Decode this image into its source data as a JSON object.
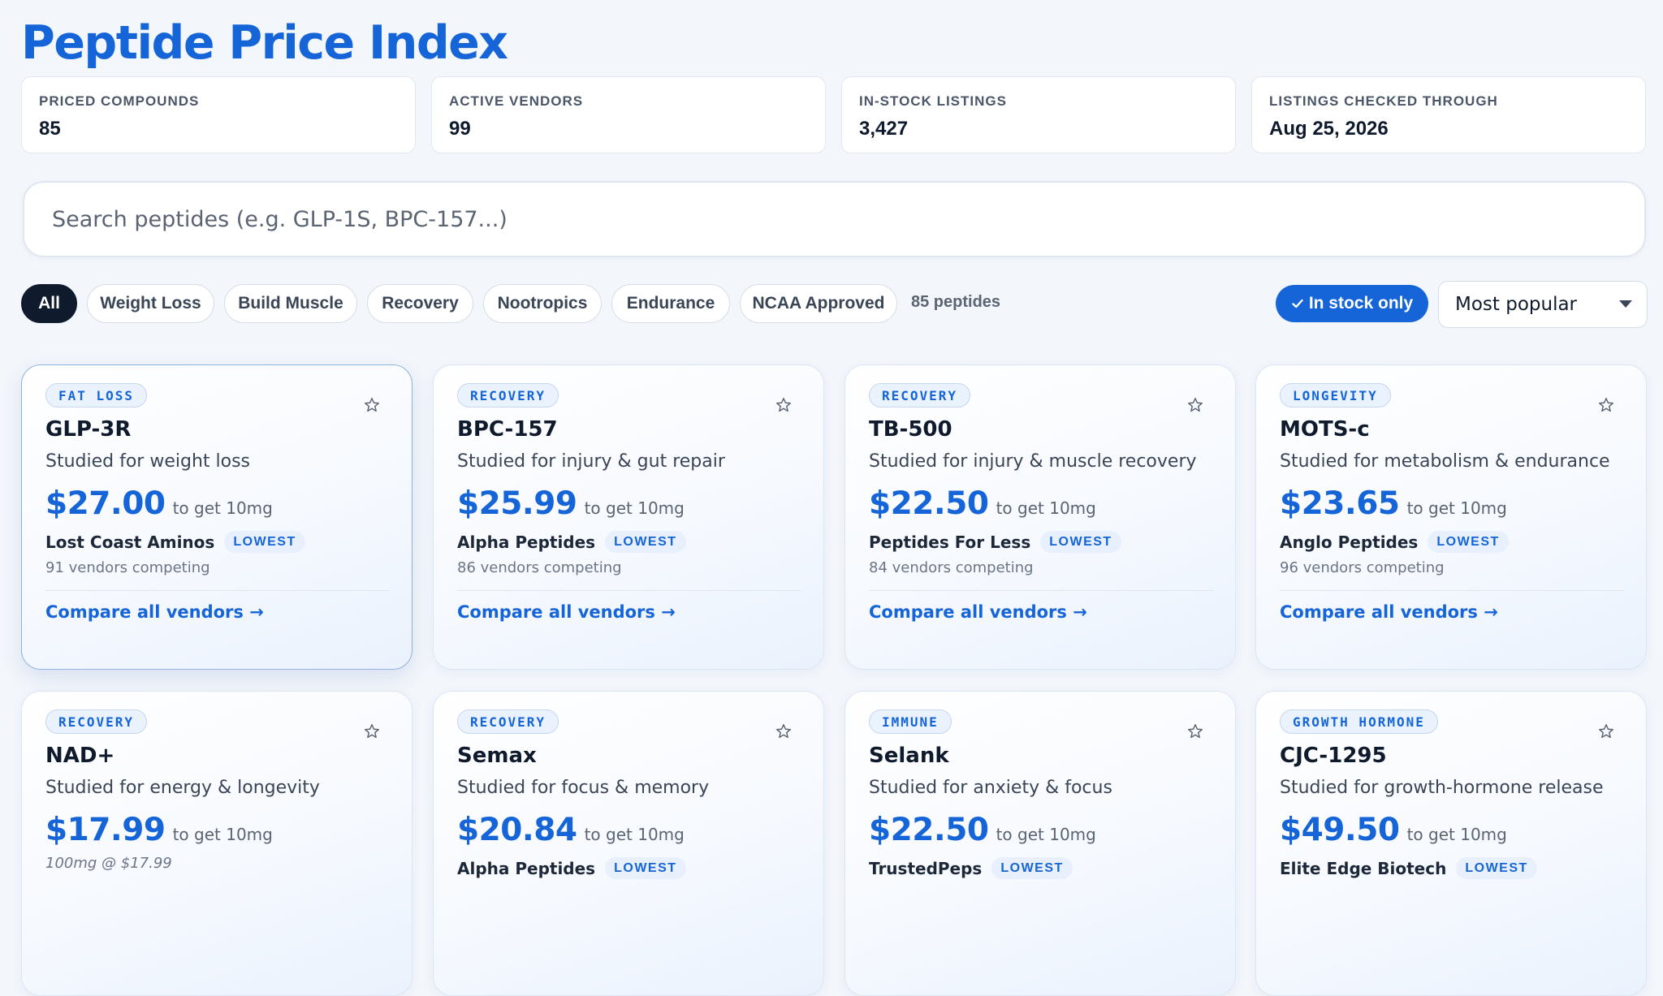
{
  "page": {
    "title": "Peptide Price Index"
  },
  "stats": [
    {
      "label": "PRICED COMPOUNDS",
      "value": "85"
    },
    {
      "label": "ACTIVE VENDORS",
      "value": "99"
    },
    {
      "label": "IN-STOCK LISTINGS",
      "value": "3,427"
    },
    {
      "label": "LISTINGS CHECKED THROUGH",
      "value": "Aug 25, 2026"
    }
  ],
  "search": {
    "placeholder": "Search peptides (e.g. GLP-1S, BPC-157...)",
    "value": ""
  },
  "filters": {
    "chips": [
      "All",
      "Weight Loss",
      "Build Muscle",
      "Recovery",
      "Nootropics",
      "Endurance",
      "NCAA Approved"
    ],
    "active": "All",
    "count_label": "85 peptides",
    "in_stock_label": "In stock only",
    "in_stock_checked": true,
    "sort_selected": "Most popular"
  },
  "colors": {
    "accent": "#1565d8",
    "dark": "#0f1b2d",
    "background": "#f3f6fb"
  },
  "icons": {
    "favorite": "star-outline-icon",
    "toggle_check": "check-icon",
    "sort_caret": "caret-down-icon",
    "link_arrow": "arrow-right-icon"
  },
  "cards": [
    {
      "category": "FAT LOSS",
      "name": "GLP-3R",
      "description": "Studied for weight loss",
      "price": "$27.00",
      "unit": "to get 10mg",
      "vendor": "Lost Coast Aminos",
      "badge": "LOWEST",
      "competing": "91 vendors competing",
      "link": "Compare all vendors →"
    },
    {
      "category": "RECOVERY",
      "name": "BPC-157",
      "description": "Studied for injury & gut repair",
      "price": "$25.99",
      "unit": "to get 10mg",
      "vendor": "Alpha Peptides",
      "badge": "LOWEST",
      "competing": "86 vendors competing",
      "link": "Compare all vendors →"
    },
    {
      "category": "RECOVERY",
      "name": "TB-500",
      "description": "Studied for injury & muscle recovery",
      "price": "$22.50",
      "unit": "to get 10mg",
      "vendor": "Peptides For Less",
      "badge": "LOWEST",
      "competing": "84 vendors competing",
      "link": "Compare all vendors →"
    },
    {
      "category": "LONGEVITY",
      "name": "MOTS-c",
      "description": "Studied for metabolism & endurance",
      "price": "$23.65",
      "unit": "to get 10mg",
      "vendor": "Anglo Peptides",
      "badge": "LOWEST",
      "competing": "96 vendors competing",
      "link": "Compare all vendors →"
    },
    {
      "category": "RECOVERY",
      "name": "NAD+",
      "description": "Studied for energy & longevity",
      "price": "$17.99",
      "unit": "to get 10mg",
      "note": "100mg @ $17.99"
    },
    {
      "category": "RECOVERY",
      "name": "Semax",
      "description": "Studied for focus & memory",
      "price": "$20.84",
      "unit": "to get 10mg",
      "vendor": "Alpha Peptides",
      "badge": "LOWEST"
    },
    {
      "category": "IMMUNE",
      "name": "Selank",
      "description": "Studied for anxiety & focus",
      "price": "$22.50",
      "unit": "to get 10mg",
      "vendor": "TrustedPeps",
      "badge": "LOWEST"
    },
    {
      "category": "GROWTH HORMONE",
      "name": "CJC-1295",
      "description": "Studied for growth-hormone release",
      "price": "$49.50",
      "unit": "to get 10mg",
      "vendor": "Elite Edge Biotech",
      "badge": "LOWEST"
    }
  ]
}
